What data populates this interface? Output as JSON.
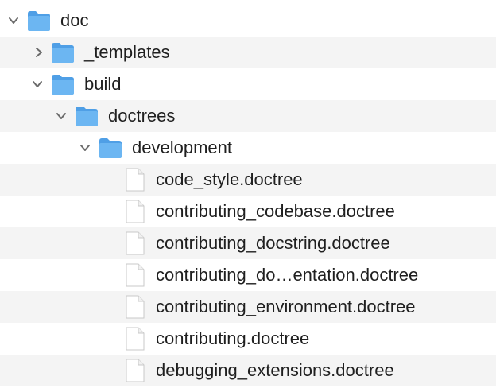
{
  "window": {
    "view": "list"
  },
  "colors": {
    "folder": "#60aef0",
    "stripe": "#f4f4f4",
    "text": "#1f1f1f",
    "chevron": "#6b6b6b"
  },
  "rows": [
    {
      "label": "doc",
      "kind": "folder",
      "expanded": true
    },
    {
      "label": "_templates",
      "kind": "folder",
      "expanded": false
    },
    {
      "label": "build",
      "kind": "folder",
      "expanded": true
    },
    {
      "label": "doctrees",
      "kind": "folder",
      "expanded": true
    },
    {
      "label": "development",
      "kind": "folder",
      "expanded": true
    },
    {
      "label": "code_style.doctree",
      "kind": "file"
    },
    {
      "label": "contributing_codebase.doctree",
      "kind": "file"
    },
    {
      "label": "contributing_docstring.doctree",
      "kind": "file"
    },
    {
      "label": "contributing_do…entation.doctree",
      "kind": "file"
    },
    {
      "label": "contributing_environment.doctree",
      "kind": "file"
    },
    {
      "label": "contributing.doctree",
      "kind": "file"
    },
    {
      "label": "debugging_extensions.doctree",
      "kind": "file"
    }
  ]
}
